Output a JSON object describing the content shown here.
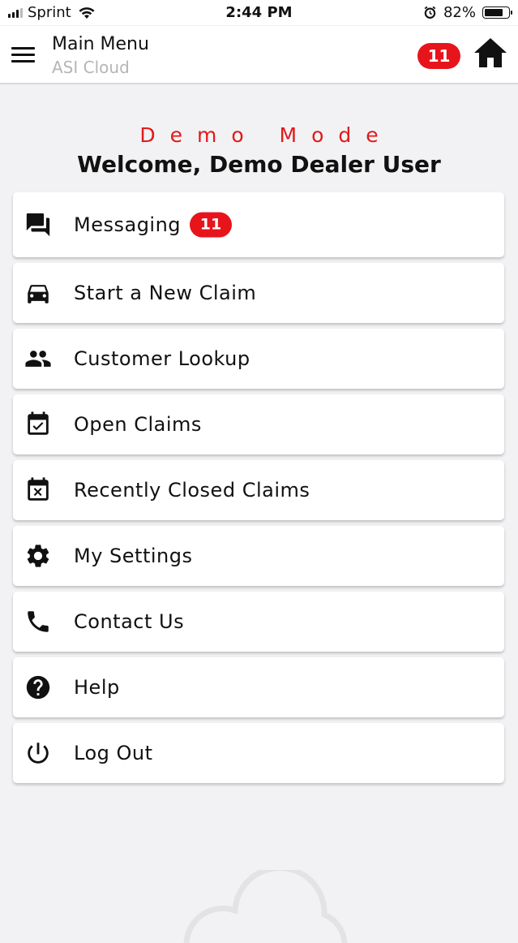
{
  "status_bar": {
    "carrier": "Sprint",
    "time": "2:44 PM",
    "battery": "82%",
    "battery_level": 0.82
  },
  "header": {
    "title": "Main Menu",
    "subtitle": "ASI Cloud",
    "notification_count": "11",
    "menu_icon": "hamburger-icon",
    "home_icon": "home-icon"
  },
  "welcome": {
    "mode": "Demo Mode",
    "greeting": "Welcome, Demo Dealer User"
  },
  "menu": {
    "items": [
      {
        "label": "Messaging",
        "icon": "forum-icon",
        "badge": "11"
      },
      {
        "label": "Start a New Claim",
        "icon": "car-icon"
      },
      {
        "label": "Customer Lookup",
        "icon": "people-icon"
      },
      {
        "label": "Open Claims",
        "icon": "calendar-check-icon"
      },
      {
        "label": "Recently Closed Claims",
        "icon": "calendar-x-icon"
      },
      {
        "label": "My Settings",
        "icon": "gear-icon"
      },
      {
        "label": "Contact Us",
        "icon": "phone-icon"
      },
      {
        "label": "Help",
        "icon": "help-icon"
      },
      {
        "label": "Log Out",
        "icon": "power-icon"
      }
    ]
  },
  "colors": {
    "accent_red": "#e8141b",
    "demo_mode_red": "#e01a1a",
    "background": "#f2f2f4"
  }
}
